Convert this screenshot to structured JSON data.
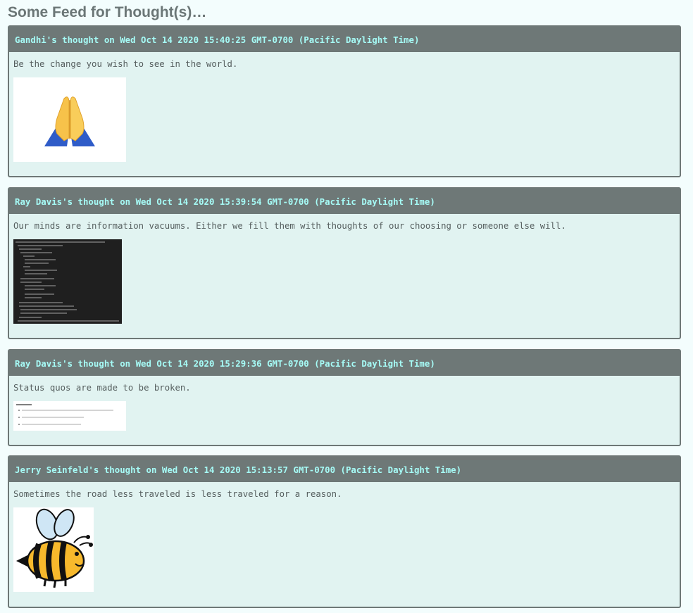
{
  "page": {
    "title": "Some Feed for Thought(s)…"
  },
  "thoughts": [
    {
      "header": "Gandhi's thought on Wed Oct 14 2020 15:40:25 GMT-0700 (Pacific Daylight Time)",
      "text": "Be the change you wish to see in the world.",
      "image": "folded-hands-emoji"
    },
    {
      "header": "Ray Davis's thought on Wed Oct 14 2020 15:39:54 GMT-0700 (Pacific Daylight Time)",
      "text": "Our minds are information vacuums. Either we fill them with thoughts of our choosing or someone else will.",
      "image": "terminal-json-screenshot"
    },
    {
      "header": "Ray Davis's thought on Wed Oct 14 2020 15:29:36 GMT-0700 (Pacific Daylight Time)",
      "text": "Status quos are made to be broken.",
      "image": "user-stories-document-screenshot"
    },
    {
      "header": "Jerry Seinfeld's thought on Wed Oct 14 2020 15:13:57 GMT-0700 (Pacific Daylight Time)",
      "text": "Sometimes the road less traveled is less traveled for a reason.",
      "image": "cartoon-bee"
    }
  ],
  "colors": {
    "background": "#f3fdfd",
    "card_background": "#e1f3f1",
    "header_background": "#6e7877",
    "header_text": "#a6fbf6",
    "title_text": "#6b7676"
  }
}
